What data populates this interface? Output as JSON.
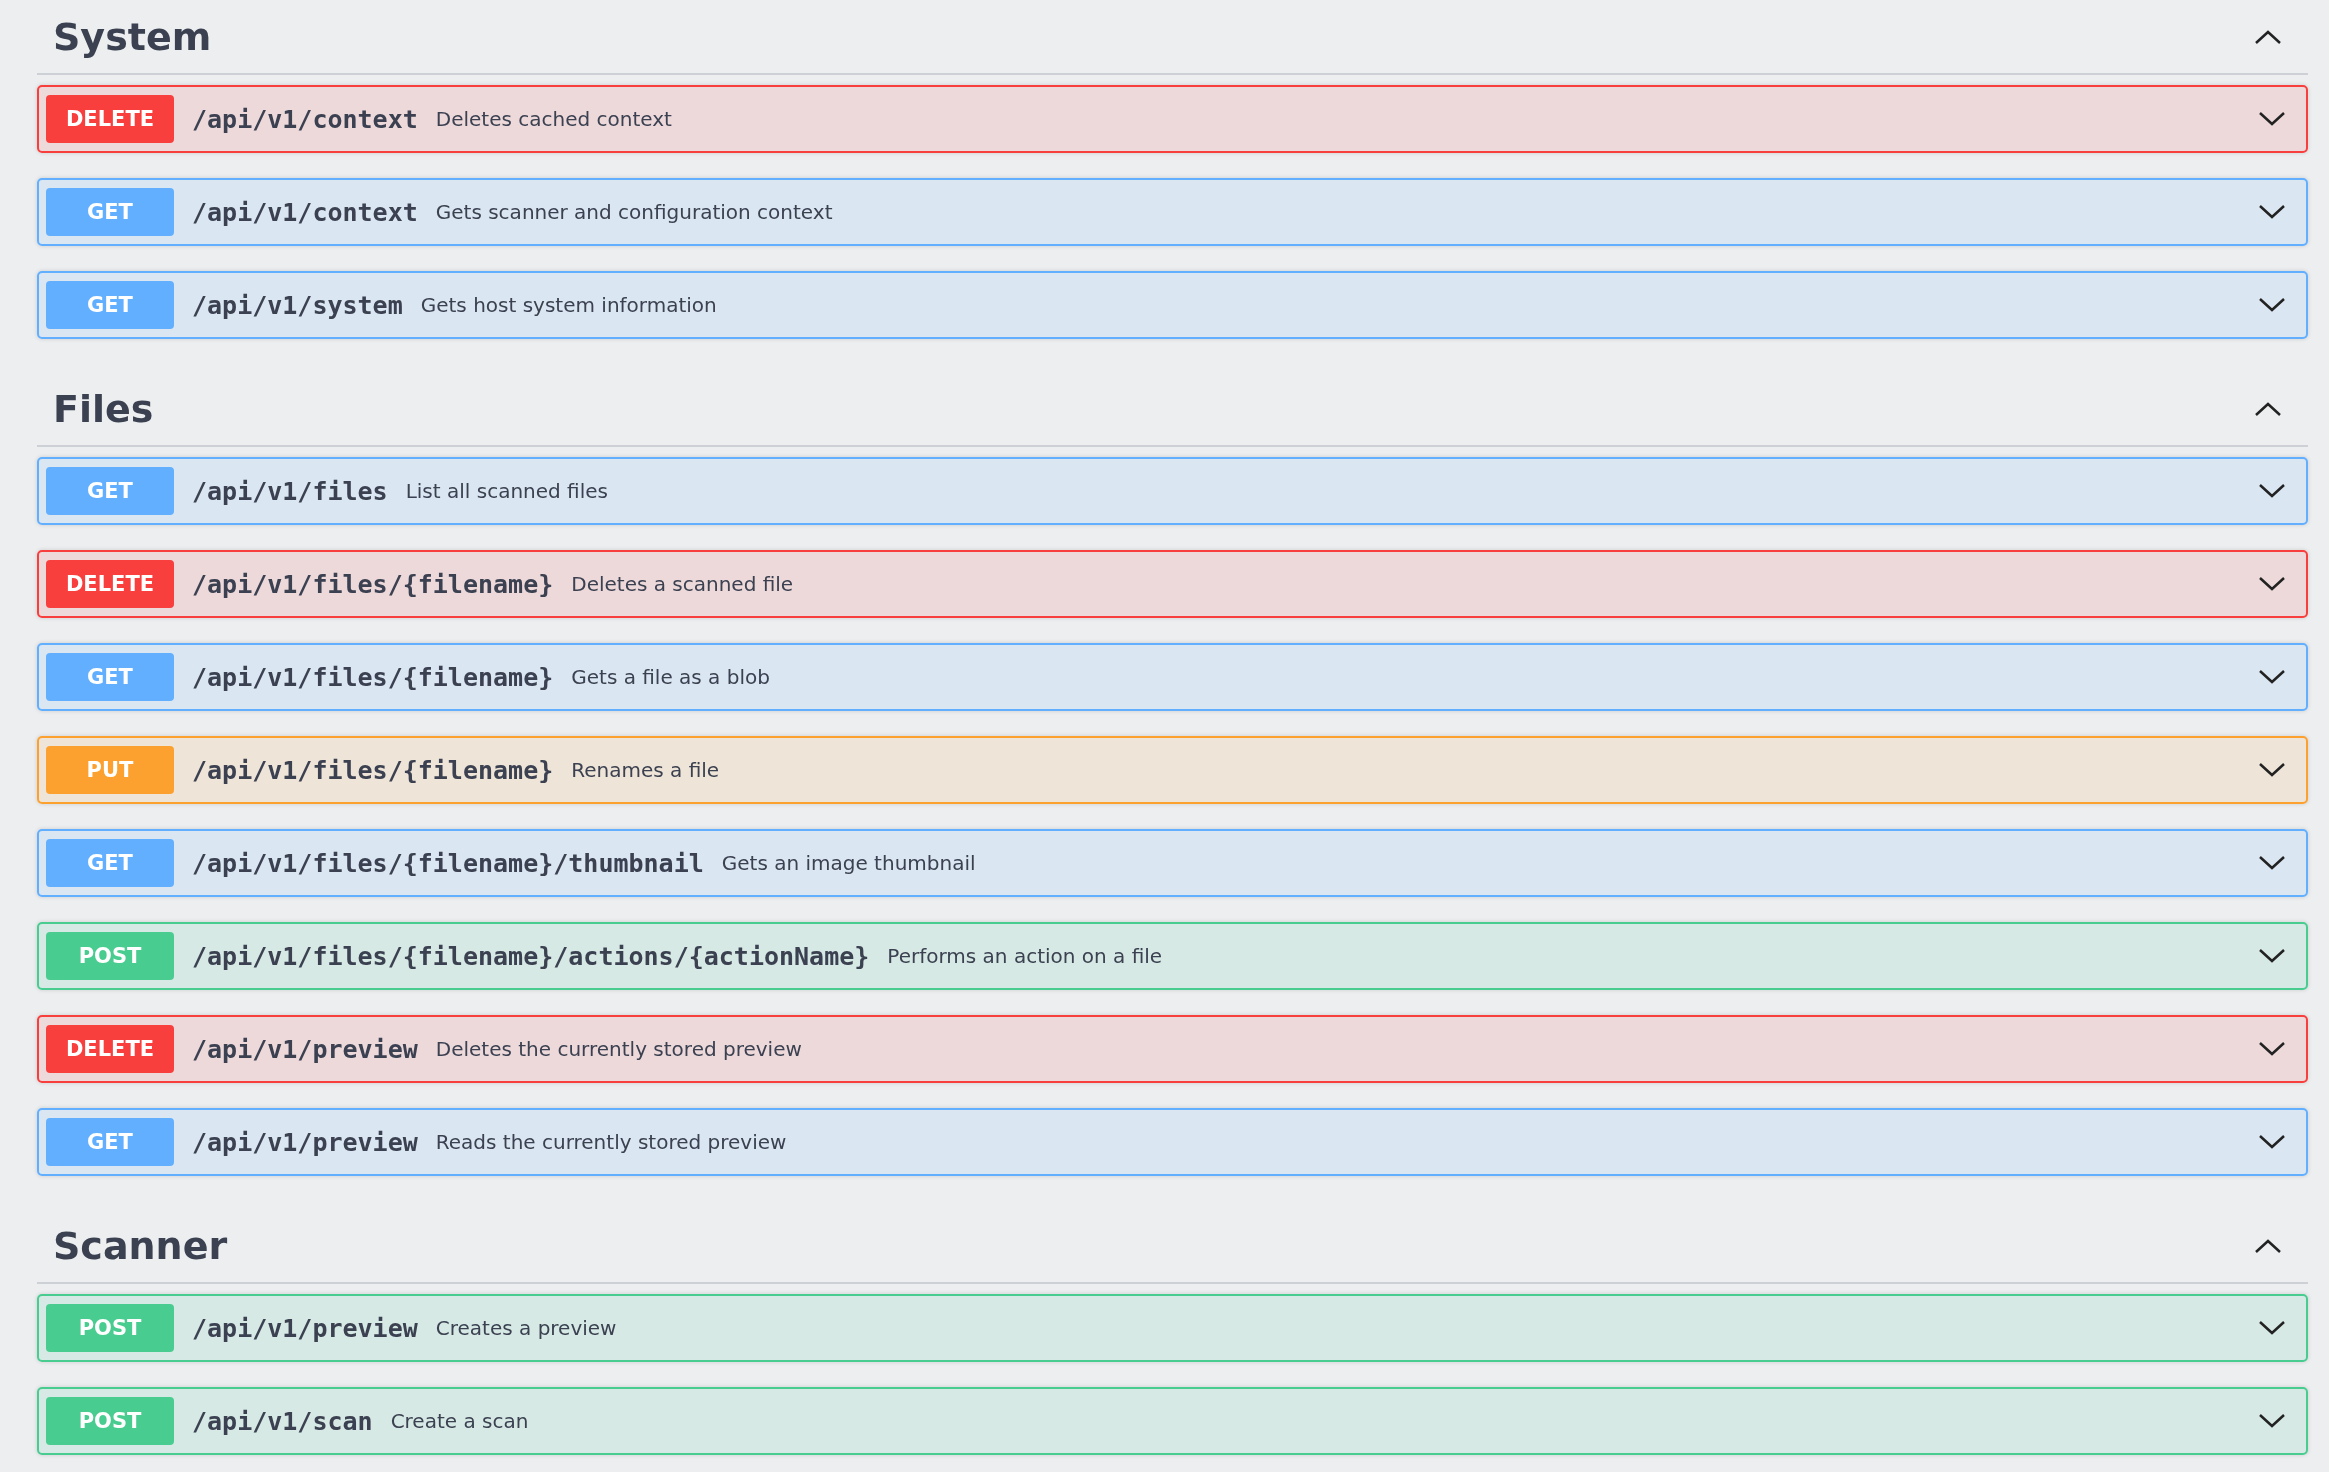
{
  "sections": [
    {
      "title": "System",
      "expanded": true,
      "operations": [
        {
          "kind": "delete",
          "method": "DELETE",
          "path": "/api/v1/context",
          "summary": "Deletes cached context",
          "expanded": false
        },
        {
          "kind": "get",
          "method": "GET",
          "path": "/api/v1/context",
          "summary": "Gets scanner and configuration context",
          "expanded": false
        },
        {
          "kind": "get",
          "method": "GET",
          "path": "/api/v1/system",
          "summary": "Gets host system information",
          "expanded": false
        }
      ]
    },
    {
      "title": "Files",
      "expanded": true,
      "operations": [
        {
          "kind": "get",
          "method": "GET",
          "path": "/api/v1/files",
          "summary": "List all scanned files",
          "expanded": false
        },
        {
          "kind": "delete",
          "method": "DELETE",
          "path": "/api/v1/files/{filename}",
          "summary": "Deletes a scanned file",
          "expanded": false
        },
        {
          "kind": "get",
          "method": "GET",
          "path": "/api/v1/files/{filename}",
          "summary": "Gets a file as a blob",
          "expanded": false
        },
        {
          "kind": "put",
          "method": "PUT",
          "path": "/api/v1/files/{filename}",
          "summary": "Renames a file",
          "expanded": false
        },
        {
          "kind": "get",
          "method": "GET",
          "path": "/api/v1/files/{filename}/thumbnail",
          "summary": "Gets an image thumbnail",
          "expanded": false
        },
        {
          "kind": "post",
          "method": "POST",
          "path": "/api/v1/files/{filename}/actions/{actionName}",
          "summary": "Performs an action on a file",
          "expanded": false
        },
        {
          "kind": "delete",
          "method": "DELETE",
          "path": "/api/v1/preview",
          "summary": "Deletes the currently stored preview",
          "expanded": false
        },
        {
          "kind": "get",
          "method": "GET",
          "path": "/api/v1/preview",
          "summary": "Reads the currently stored preview",
          "expanded": false
        }
      ]
    },
    {
      "title": "Scanner",
      "expanded": true,
      "operations": [
        {
          "kind": "post",
          "method": "POST",
          "path": "/api/v1/preview",
          "summary": "Creates a preview",
          "expanded": false
        },
        {
          "kind": "post",
          "method": "POST",
          "path": "/api/v1/scan",
          "summary": "Create a scan",
          "expanded": false
        }
      ]
    }
  ]
}
